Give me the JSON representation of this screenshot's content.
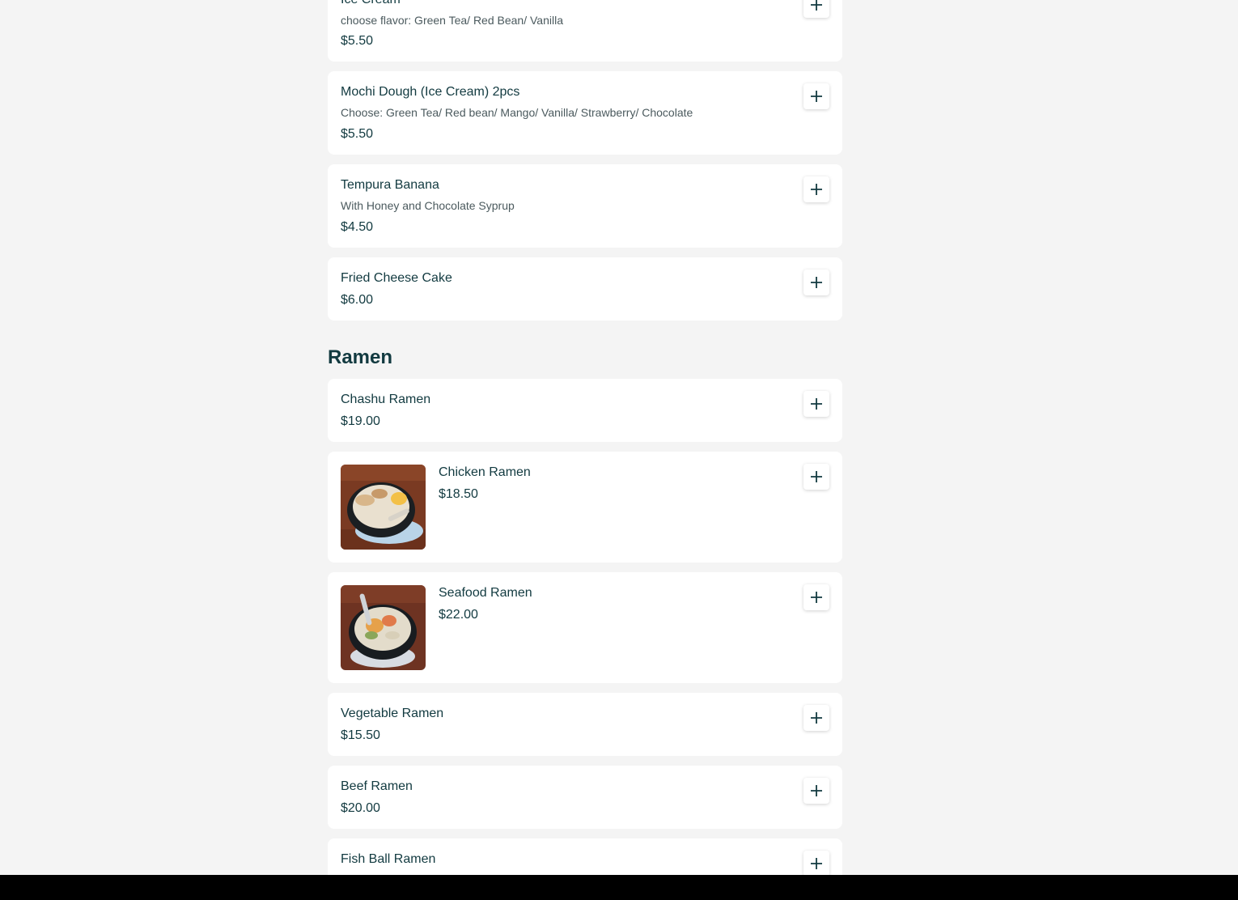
{
  "desserts": [
    {
      "name": "Ice Cream",
      "description": "choose flavor: Green Tea/ Red Bean/ Vanilla",
      "price": "$5.50"
    },
    {
      "name": "Mochi Dough (Ice Cream) 2pcs",
      "description": "Choose: Green Tea/ Red bean/ Mango/ Vanilla/ Strawberry/ Chocolate",
      "price": "$5.50"
    },
    {
      "name": "Tempura Banana",
      "description": "With Honey and Chocolate Syprup",
      "price": "$4.50"
    },
    {
      "name": "Fried Cheese Cake",
      "price": "$6.00"
    }
  ],
  "ramen_section": {
    "title": "Ramen",
    "items": [
      {
        "name": "Chashu Ramen",
        "price": "$19.00"
      },
      {
        "name": "Chicken Ramen",
        "price": "$18.50"
      },
      {
        "name": "Seafood Ramen",
        "price": "$22.00"
      },
      {
        "name": "Vegetable Ramen",
        "price": "$15.50"
      },
      {
        "name": "Beef Ramen",
        "price": "$20.00"
      },
      {
        "name": "Fish Ball Ramen",
        "price": ""
      }
    ]
  },
  "icons": {
    "add": "plus-icon"
  },
  "colors": {
    "background": "#f4f4f4",
    "card": "#ffffff",
    "text": "#123a40",
    "muted_text": "#4b5a5e"
  }
}
